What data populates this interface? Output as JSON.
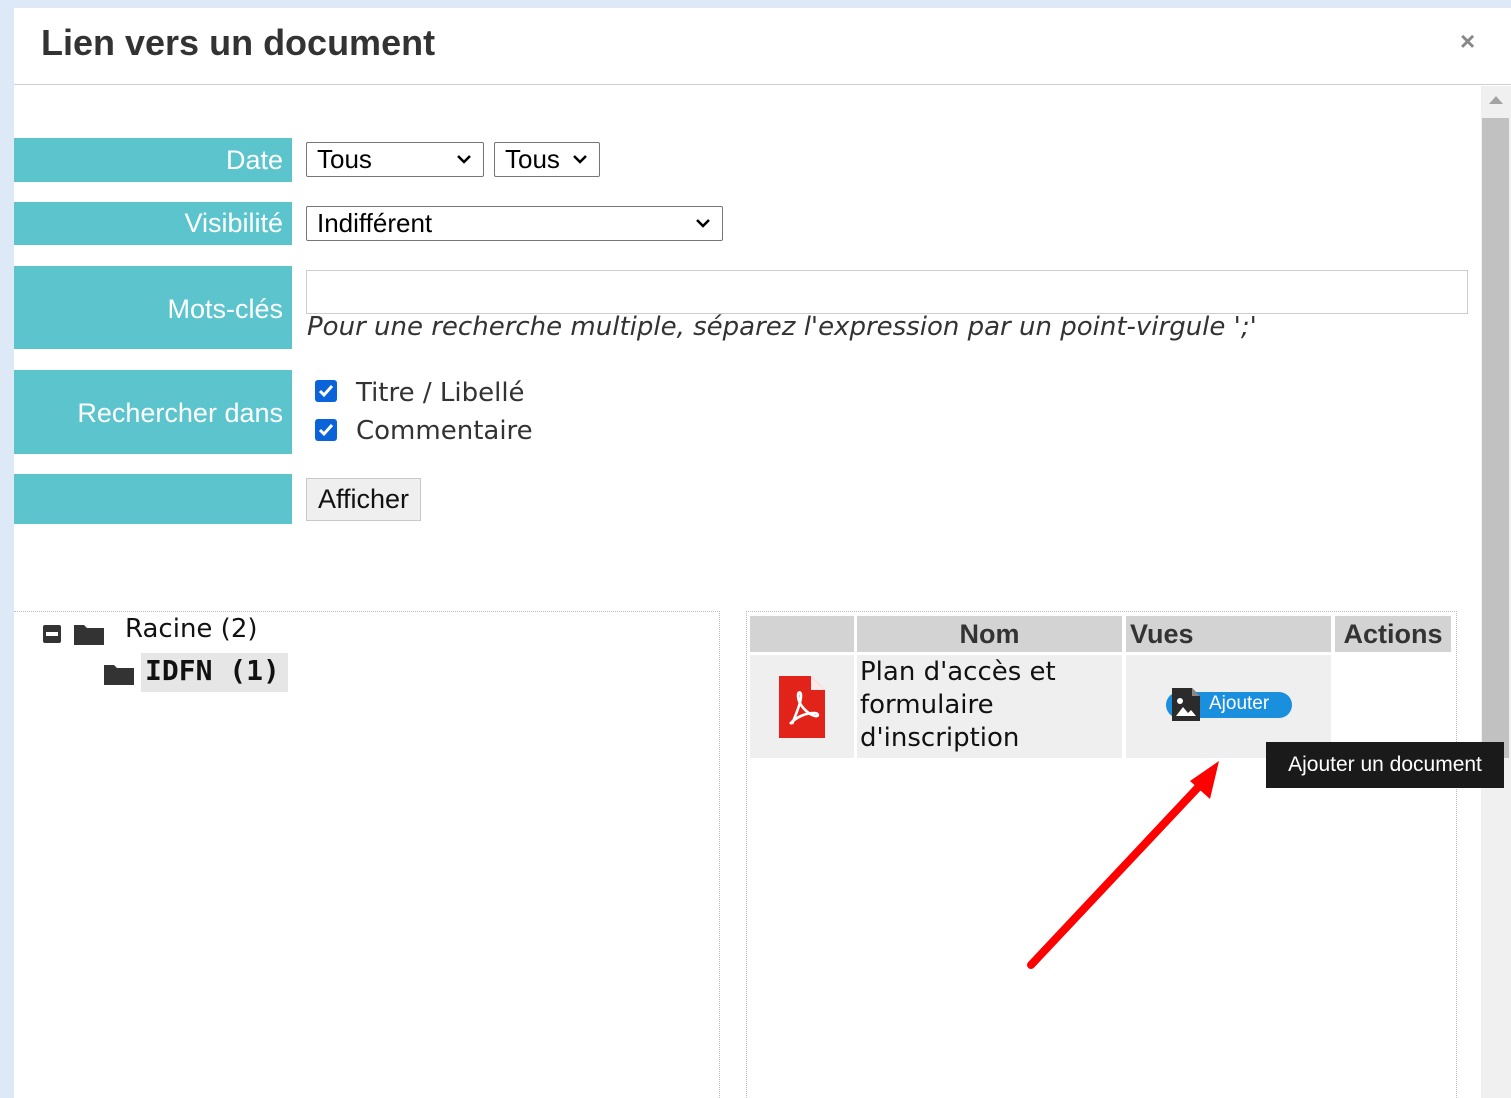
{
  "dialog": {
    "title": "Lien vers un document",
    "close_symbol": "×"
  },
  "filters": {
    "date_label": "Date",
    "date_select_1": "Tous",
    "date_select_2": "Tous",
    "visibility_label": "Visibilité",
    "visibility_value": "Indifférent",
    "keywords_label": "Mots-clés",
    "keywords_value": "",
    "keywords_hint": "Pour une recherche multiple, séparez l'expression par un point-virgule ';'",
    "search_in_label": "Rechercher dans",
    "search_in_options": [
      {
        "label": "Titre / Libellé",
        "checked": true
      },
      {
        "label": "Commentaire",
        "checked": true
      }
    ],
    "submit_label": "Afficher"
  },
  "tree": {
    "root_label": "Racine (2)",
    "child_label": "IDFN (1)",
    "icons": {
      "collapse": "minus-square-icon",
      "folder": "folder-icon"
    }
  },
  "documents": {
    "columns": [
      "",
      "Nom",
      "Vues",
      "Actions"
    ],
    "rows": [
      {
        "icon": "pdf-file-icon",
        "name": "Plan d'accès et formulaire d'inscription",
        "add_label": "Ajouter"
      }
    ]
  },
  "tooltip": "Ajouter un document",
  "colors": {
    "label_bg": "#5bc4cc",
    "header_cell_bg": "#d3d3d3",
    "pdf_red": "#e2231a",
    "add_button_blue": "#1a8fdd",
    "annotation_arrow": "#ff0000",
    "backdrop": "#dde9f6"
  }
}
